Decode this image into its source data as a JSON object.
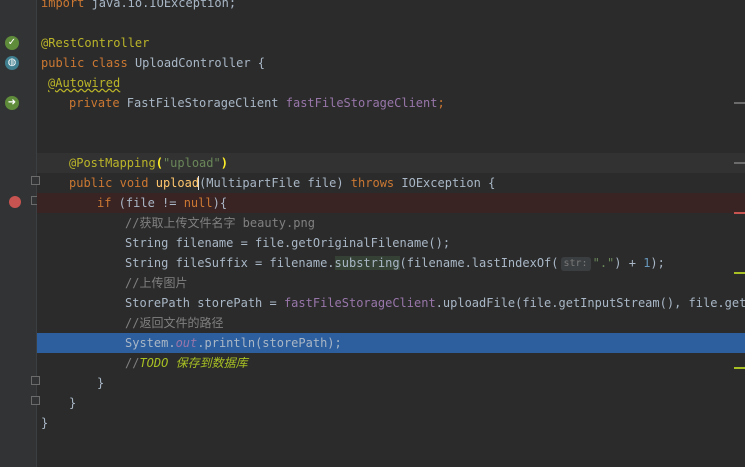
{
  "editor": {
    "lines": {
      "l0": {
        "a": "import",
        "b": " java.io.IOException;"
      },
      "l2": {
        "ann": "@RestController"
      },
      "l3": {
        "kw1": "public",
        "kw2": "class",
        "name": " UploadController {"
      },
      "l4": {
        "ann": "@Autowired"
      },
      "l5": {
        "kw": "private",
        "type": " FastFileStorageClient ",
        "field": "fastFileStorageClient",
        "end": ";"
      },
      "l8": {
        "ann": "@PostMapping",
        "p1": "(",
        "str": "\"upload\"",
        "p2": ")"
      },
      "l9": {
        "kw1": "public",
        "kw2": "void",
        "name": " upload",
        "args": "(MultipartFile file) ",
        "kw3": "throws",
        "rest": " IOException {"
      },
      "l10": {
        "kw1": "if",
        "mid": " (file != ",
        "kw2": "null",
        "end": "){"
      },
      "l11": {
        "cmt": "//获取上传文件名字 beauty.png"
      },
      "l12": {
        "text": "String filename = file.getOriginalFilename();"
      },
      "l13": {
        "a": "String fileSuffix = filename.",
        "m": "substring",
        "b": "(filename.lastIndexOf(",
        "hint": "str:",
        "s": "\".\"",
        "c": ") + ",
        "n": "1",
        "d": ");"
      },
      "l14": {
        "cmt": "//上传图片"
      },
      "l15": {
        "a": "StorePath storePath = ",
        "f": "fastFileStorageClient",
        "b": ".uploadFile(file.getInputStream(), file.getSiz"
      },
      "l16": {
        "cmt": "//返回文件的路径"
      },
      "l17": {
        "a": "System.",
        "f": "out",
        "b": ".println(storePath);"
      },
      "l18": {
        "cmt": "//",
        "todo": "TODO 保存到数据库"
      },
      "l19": {
        "text": "}"
      },
      "l20": {
        "text": "}"
      },
      "l21": {
        "text": "}"
      }
    }
  },
  "colors": {
    "background": "#2b2b2b",
    "execution_line": "#2d5e9e",
    "breakpoint": "#c75450",
    "keyword": "#cc7832",
    "annotation": "#bbb529",
    "string": "#6a8759"
  },
  "icons": [
    "spring-bean-icon",
    "spring-globe-icon",
    "spring-autowired-icon",
    "breakpoint-icon",
    "fold-marker-icon"
  ]
}
